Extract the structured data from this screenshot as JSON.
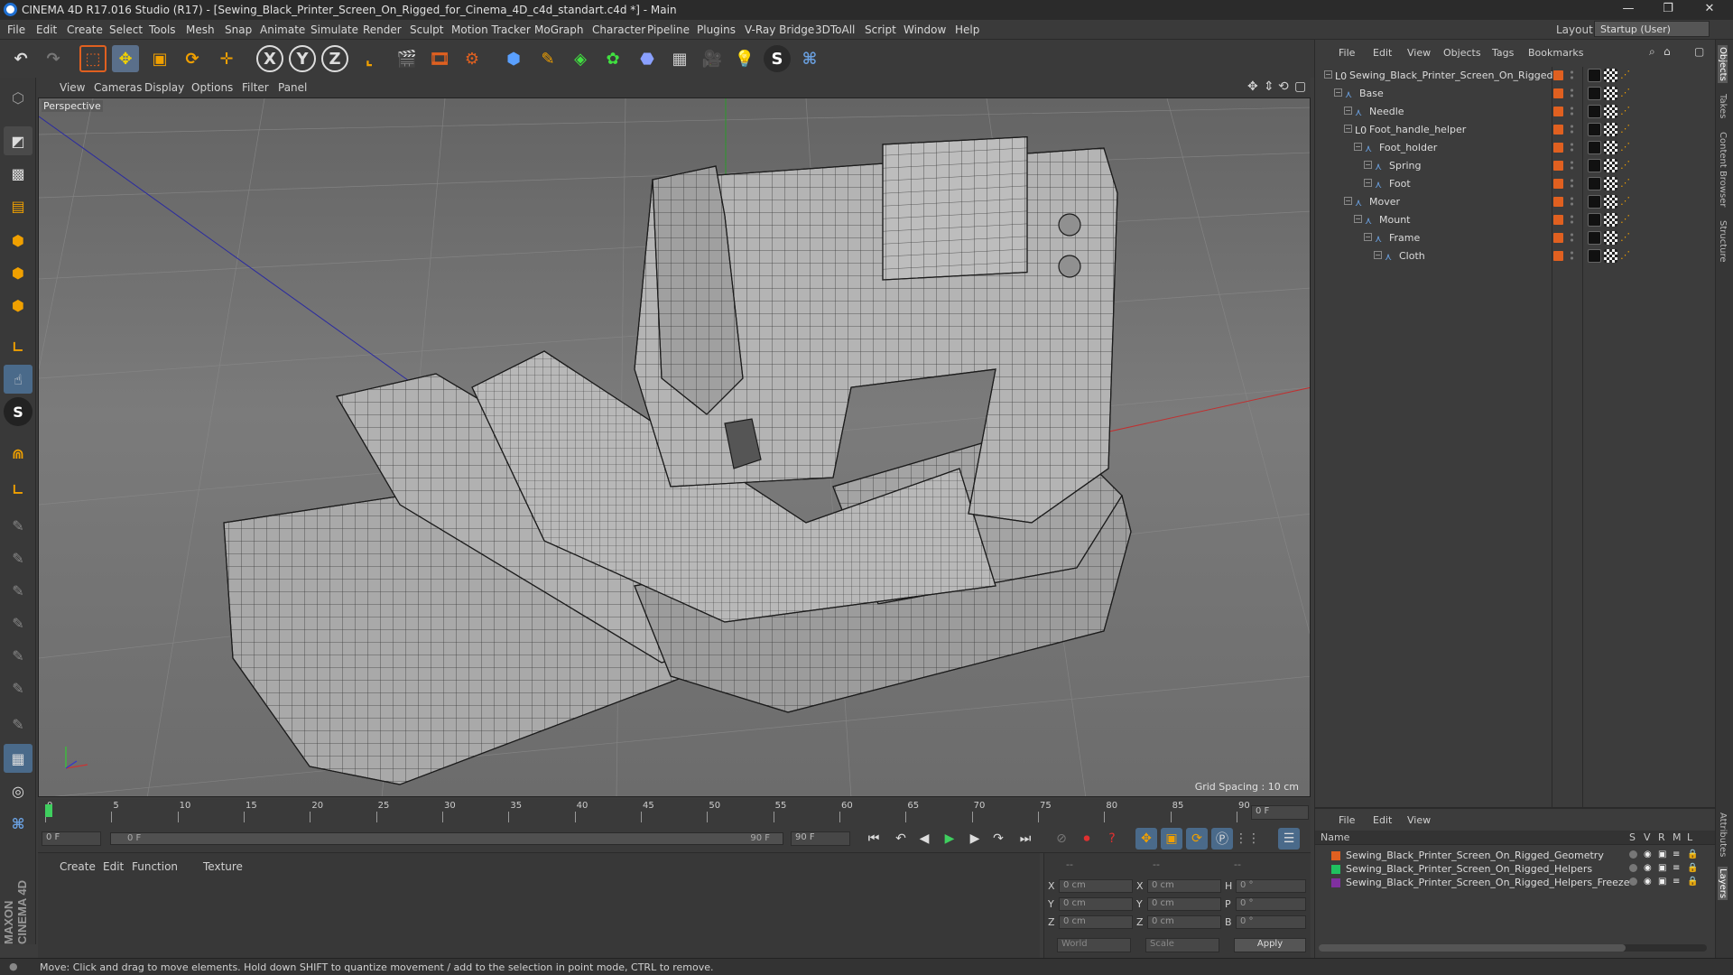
{
  "window": {
    "title": "CINEMA 4D R17.016 Studio (R17) - [Sewing_Black_Printer_Screen_On_Rigged_for_Cinema_4D_c4d_standart.c4d *] - Main",
    "minimize": "—",
    "maximize": "❐",
    "close": "✕"
  },
  "menu": [
    "File",
    "Edit",
    "Create",
    "Select",
    "Tools",
    "Mesh",
    "Snap",
    "Animate",
    "Simulate",
    "Render",
    "Sculpt",
    "Motion Tracker",
    "MoGraph",
    "Character",
    "Pipeline",
    "Plugins",
    "V-Ray Bridge",
    "3DToAll",
    "Script",
    "Window",
    "Help"
  ],
  "layout": {
    "label": "Layout:",
    "value": "Startup (User)"
  },
  "toolbar": {
    "x": "X",
    "y": "Y",
    "z": "Z"
  },
  "viewport": {
    "menu": [
      "View",
      "Cameras",
      "Display",
      "Options",
      "Filter",
      "Panel"
    ],
    "label": "Perspective",
    "grid_spacing": "Grid Spacing : 10 cm"
  },
  "objects_panel": {
    "menu": [
      "File",
      "Edit",
      "View",
      "Objects",
      "Tags",
      "Bookmarks"
    ],
    "items": [
      {
        "name": "Sewing_Black_Printer_Screen_On_Rigged",
        "depth": 0,
        "icon": "null-icon"
      },
      {
        "name": "Base",
        "depth": 1,
        "icon": "joint-icon"
      },
      {
        "name": "Needle",
        "depth": 2,
        "icon": "joint-icon"
      },
      {
        "name": "Foot_handle_helper",
        "depth": 2,
        "icon": "null-icon"
      },
      {
        "name": "Foot_holder",
        "depth": 3,
        "icon": "joint-icon"
      },
      {
        "name": "Spring",
        "depth": 4,
        "icon": "joint-icon"
      },
      {
        "name": "Foot",
        "depth": 4,
        "icon": "joint-icon"
      },
      {
        "name": "Mover",
        "depth": 2,
        "icon": "joint-icon"
      },
      {
        "name": "Mount",
        "depth": 3,
        "icon": "joint-icon"
      },
      {
        "name": "Frame",
        "depth": 4,
        "icon": "joint-icon"
      },
      {
        "name": "Cloth",
        "depth": 5,
        "icon": "joint-icon"
      }
    ]
  },
  "layers_panel": {
    "menu": [
      "File",
      "Edit",
      "View"
    ],
    "header": {
      "name": "Name",
      "cols": [
        "S",
        "V",
        "R",
        "M",
        "L"
      ]
    },
    "items": [
      {
        "name": "Sewing_Black_Printer_Screen_On_Rigged_Geometry",
        "color": "#e06020"
      },
      {
        "name": "Sewing_Black_Printer_Screen_On_Rigged_Helpers",
        "color": "#20c060"
      },
      {
        "name": "Sewing_Black_Printer_Screen_On_Rigged_Helpers_Freeze",
        "color": "#8030a0"
      }
    ]
  },
  "timeline": {
    "ticks": [
      "0",
      "5",
      "10",
      "15",
      "20",
      "25",
      "30",
      "35",
      "40",
      "45",
      "50",
      "55",
      "60",
      "65",
      "70",
      "75",
      "80",
      "85",
      "90"
    ],
    "current_frame_field": "0 F",
    "start_field": "0 F",
    "range_start": "0 F",
    "range_end": "90 F",
    "end_field": "90 F"
  },
  "material_panel": {
    "menu": [
      "Create",
      "Edit",
      "Function",
      "Texture"
    ]
  },
  "coords": {
    "header": [
      "--",
      "--",
      "--"
    ],
    "rows": [
      {
        "a": "X",
        "av": "0 cm",
        "b": "X",
        "bv": "0 cm",
        "c": "H",
        "cv": "0 °"
      },
      {
        "a": "Y",
        "av": "0 cm",
        "b": "Y",
        "bv": "0 cm",
        "c": "P",
        "cv": "0 °"
      },
      {
        "a": "Z",
        "av": "0 cm",
        "b": "Z",
        "bv": "0 cm",
        "c": "B",
        "cv": "0 °"
      }
    ],
    "space": "World",
    "mode": "Scale",
    "apply": "Apply"
  },
  "status": "Move: Click and drag to move elements. Hold down SHIFT to quantize movement / add to the selection in point mode, CTRL to remove.",
  "right_tabs": [
    "Objects",
    "Takes",
    "Content Browser",
    "Structure"
  ],
  "right_tabs_bottom": [
    "Attributes",
    "Layers"
  ],
  "brand": "MAXON CINEMA 4D"
}
